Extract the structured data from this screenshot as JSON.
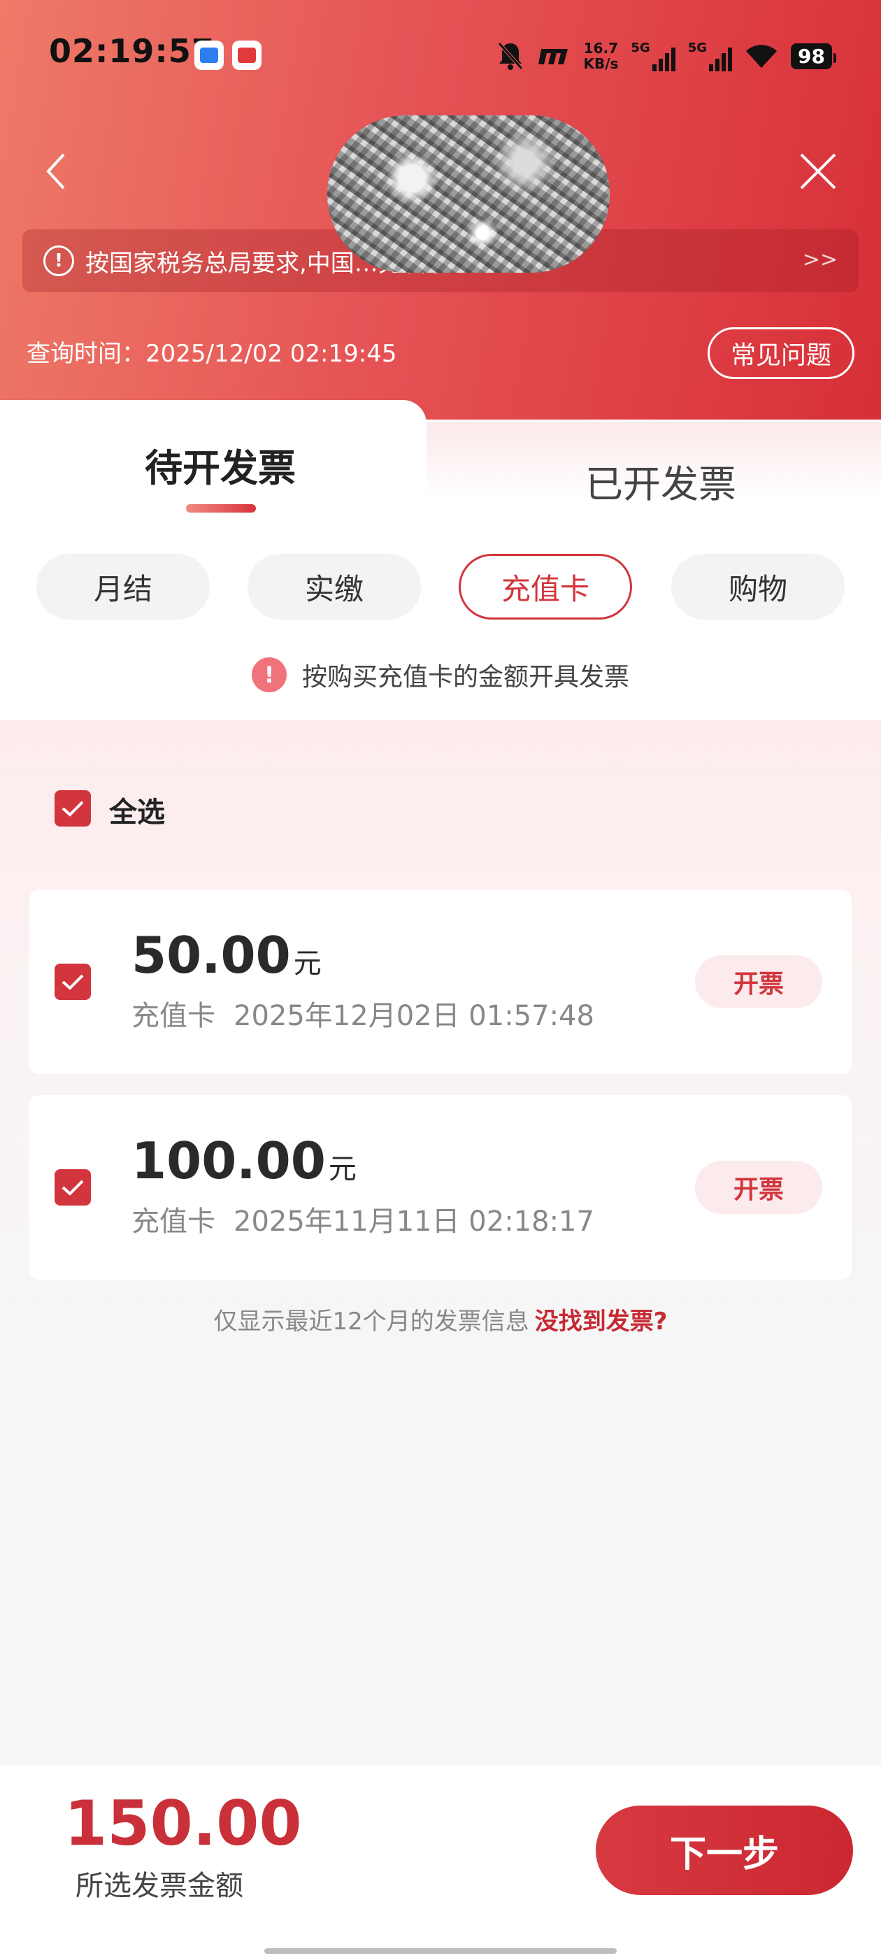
{
  "status_bar": {
    "time": "02:19:57",
    "net_speed_value": "16.7",
    "net_speed_unit": "KB/s",
    "signal1_label": "5G",
    "signal2_label": "5G",
    "battery": "98"
  },
  "header": {
    "notice_text": "按国家税务总局要求,中国…充发票",
    "query_time_label": "查询时间：",
    "query_time_value": "2025/12/02 02:19:45",
    "faq_label": "常见问题"
  },
  "tabs": [
    {
      "label": "待开发票",
      "active": true
    },
    {
      "label": "已开发票",
      "active": false
    }
  ],
  "chips": [
    {
      "label": "月结",
      "active": false
    },
    {
      "label": "实缴",
      "active": false
    },
    {
      "label": "充值卡",
      "active": true
    },
    {
      "label": "购物",
      "active": false
    }
  ],
  "hint": {
    "icon": "!",
    "text": "按购买充值卡的金额开具发票"
  },
  "select_all": {
    "label": "全选",
    "checked": true
  },
  "records": [
    {
      "amount": "50.00",
      "unit": "元",
      "type": "充值卡",
      "datetime": "2025年12月02日 01:57:48",
      "button": "开票",
      "checked": true
    },
    {
      "amount": "100.00",
      "unit": "元",
      "type": "充值卡",
      "datetime": "2025年11月11日 02:18:17",
      "button": "开票",
      "checked": true
    }
  ],
  "footer_note": {
    "text": "仅显示最近12个月的发票信息",
    "link": "没找到发票?"
  },
  "bottom": {
    "total": "150.00",
    "total_label": "所选发票金额",
    "next_label": "下一步"
  },
  "colors": {
    "accent": "#d2353d",
    "header_start": "#ee7a68",
    "header_end": "#d72f37"
  }
}
